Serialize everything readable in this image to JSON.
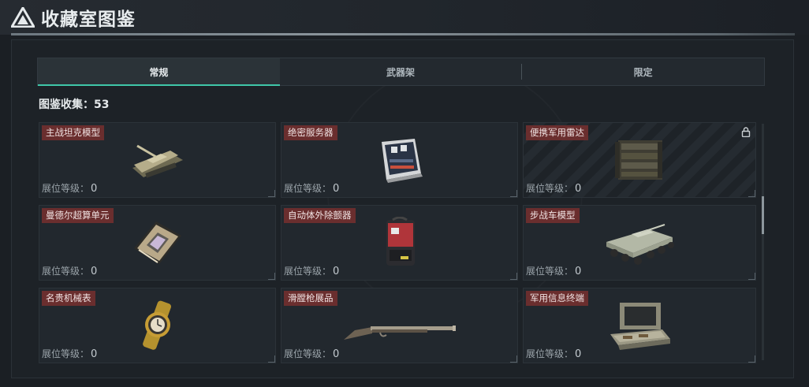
{
  "header": {
    "title": "收藏室图鉴"
  },
  "tabs": [
    {
      "label": "常规",
      "active": true
    },
    {
      "label": "武器架",
      "active": false
    },
    {
      "label": "限定",
      "active": false
    }
  ],
  "collection": {
    "label": "图鉴收集：",
    "value": "53"
  },
  "cards": [
    {
      "name": "主战坦克模型",
      "level_label": "展位等级：",
      "level": "0",
      "icon": "tank-model-icon",
      "locked": false
    },
    {
      "name": "绝密服务器",
      "level_label": "展位等级：",
      "level": "0",
      "icon": "server-icon",
      "locked": false
    },
    {
      "name": "便携军用雷达",
      "level_label": "展位等级：",
      "level": "0",
      "icon": "radar-icon",
      "locked": true
    },
    {
      "name": "曼德尔超算单元",
      "level_label": "展位等级：",
      "level": "0",
      "icon": "compute-unit-icon",
      "locked": false
    },
    {
      "name": "自动体外除颤器",
      "level_label": "展位等级：",
      "level": "0",
      "icon": "defibrillator-icon",
      "locked": false
    },
    {
      "name": "步战车模型",
      "level_label": "展位等级：",
      "level": "0",
      "icon": "ifv-model-icon",
      "locked": false
    },
    {
      "name": "名贵机械表",
      "level_label": "展位等级：",
      "level": "0",
      "icon": "watch-icon",
      "locked": false
    },
    {
      "name": "滑膛枪展品",
      "level_label": "展位等级：",
      "level": "0",
      "icon": "musket-icon",
      "locked": false
    },
    {
      "name": "军用信息终端",
      "level_label": "展位等级：",
      "level": "0",
      "icon": "terminal-icon",
      "locked": false
    }
  ],
  "colors": {
    "accent": "#3fc7a9",
    "name_tag": "#6a2e2e",
    "background": "#1b1f24"
  }
}
